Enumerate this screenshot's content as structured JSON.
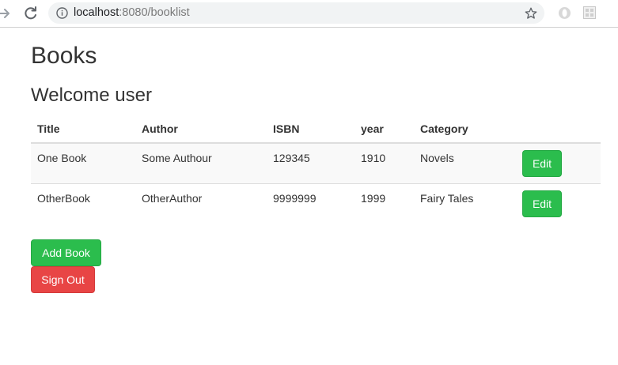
{
  "browser": {
    "url_host": "localhost",
    "url_rest": ":8080/booklist",
    "icons": {
      "forward": "forward-arrow-icon",
      "reload": "reload-icon",
      "info": "info-icon",
      "bookmark": "star-icon",
      "extension_1": "opera-extension-icon",
      "extension_2": "grid-extension-icon"
    }
  },
  "page": {
    "title": "Books",
    "welcome": "Welcome user"
  },
  "table": {
    "headers": [
      "Title",
      "Author",
      "ISBN",
      "year",
      "Category"
    ],
    "rows": [
      {
        "title": "One Book",
        "author": "Some Authour",
        "isbn": "129345",
        "year": "1910",
        "category": "Novels",
        "action": "Edit"
      },
      {
        "title": "OtherBook",
        "author": "OtherAuthor",
        "isbn": "9999999",
        "year": "1999",
        "category": "Fairy Tales",
        "action": "Edit"
      }
    ]
  },
  "actions": {
    "add_label": "Add Book",
    "signout_label": "Sign Out"
  },
  "colors": {
    "success": "#2bbd4d",
    "danger": "#e84545",
    "text": "#333333",
    "row_stripe": "#f9f9f9"
  }
}
